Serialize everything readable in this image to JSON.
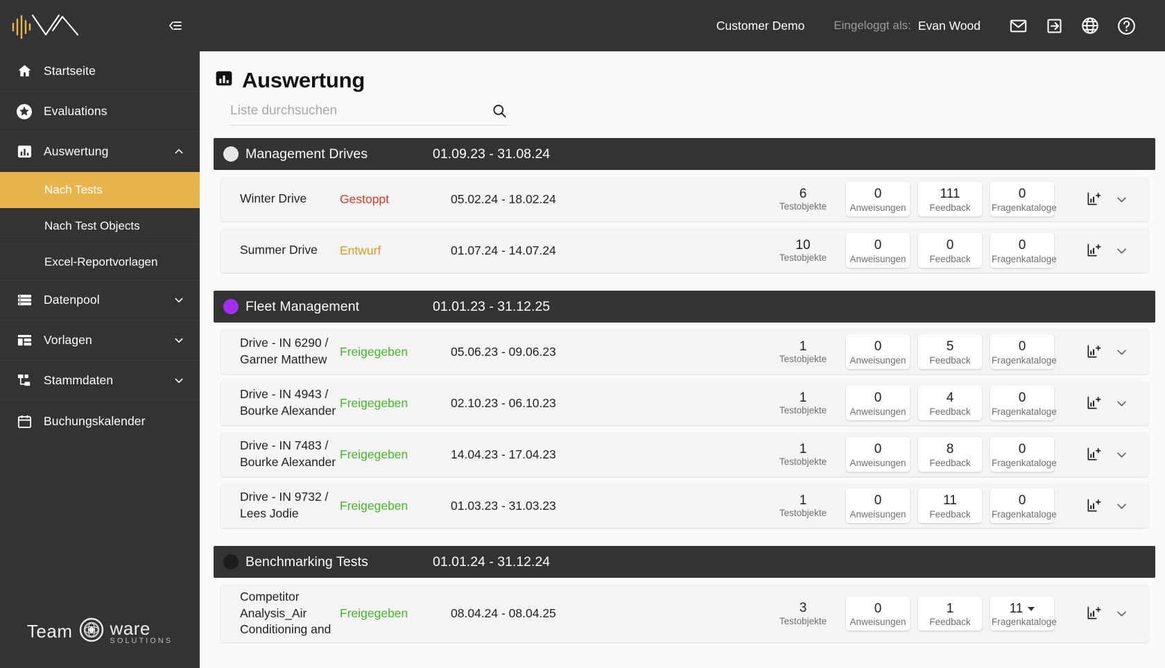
{
  "sidebar": {
    "brand_logo_name": "ava-wave-logo",
    "collapse_label": "collapse-sidebar",
    "items": [
      {
        "label": "Startseite",
        "icon": "home-icon",
        "expandable": false,
        "expanded": false
      },
      {
        "label": "Evaluations",
        "icon": "star-icon",
        "expandable": false,
        "expanded": false
      },
      {
        "label": "Auswertung",
        "icon": "bar-chart-icon",
        "expandable": true,
        "expanded": true
      },
      {
        "label": "Datenpool",
        "icon": "database-icon",
        "expandable": true,
        "expanded": false
      },
      {
        "label": "Vorlagen",
        "icon": "layout-icon",
        "expandable": true,
        "expanded": false
      },
      {
        "label": "Stammdaten",
        "icon": "hierarchy-icon",
        "expandable": true,
        "expanded": false
      },
      {
        "label": "Buchungskalender",
        "icon": "calendar-icon",
        "expandable": false,
        "expanded": false
      }
    ],
    "sub_items": [
      {
        "label": "Nach Tests",
        "selected": true
      },
      {
        "label": "Nach Test Objects",
        "selected": false
      },
      {
        "label": "Excel-Reportvorlagen",
        "selected": false
      }
    ],
    "footer_logo": {
      "left": "Team",
      "right": "ware",
      "tagline": "SOLUTIONS"
    },
    "accent_color": "#e8b54d",
    "background_color": "#333333"
  },
  "topbar": {
    "customer": "Customer Demo",
    "logged_as_label": "Eingeloggt als:",
    "user_name": "Evan Wood",
    "icons": [
      {
        "name": "mail-icon"
      },
      {
        "name": "logout-icon"
      },
      {
        "name": "globe-icon"
      },
      {
        "name": "help-icon"
      }
    ]
  },
  "page": {
    "title": "Auswertung",
    "title_icon": "bar-chart-icon"
  },
  "search": {
    "placeholder": "Liste durchsuchen",
    "value": "",
    "icon": "search-icon"
  },
  "columns": {
    "testobjekte": "Testobjekte",
    "anweisungen": "Anweisungen",
    "feedback": "Feedback",
    "fragenkataloge": "Fragenkataloge"
  },
  "groups": [
    {
      "name": "Management Drives",
      "range": "01.09.23 - 31.08.24",
      "dot_color": "#e6e6e6",
      "rows": [
        {
          "name": "Winter Drive",
          "status": "Gestoppt",
          "status_class": "st-stopped",
          "range": "05.02.24 - 18.02.24",
          "testobjekte": "6",
          "anweisungen": "0",
          "feedback": "111",
          "fragenkataloge": "0",
          "fragenkataloge_dropdown": false
        },
        {
          "name": "Summer Drive",
          "status": "Entwurf",
          "status_class": "st-draft",
          "range": "01.07.24 - 14.07.24",
          "testobjekte": "10",
          "anweisungen": "0",
          "feedback": "0",
          "fragenkataloge": "0",
          "fragenkataloge_dropdown": false
        }
      ]
    },
    {
      "name": "Fleet Management",
      "range": "01.01.23 - 31.12.25",
      "dot_color": "#a02ff0",
      "rows": [
        {
          "name": "Drive - IN 6290 / Garner Matthew",
          "status": "Freigegeben",
          "status_class": "st-released",
          "range": "05.06.23 - 09.06.23",
          "testobjekte": "1",
          "anweisungen": "0",
          "feedback": "5",
          "fragenkataloge": "0",
          "fragenkataloge_dropdown": false
        },
        {
          "name": "Drive - IN 4943 / Bourke Alexander",
          "status": "Freigegeben",
          "status_class": "st-released",
          "range": "02.10.23 - 06.10.23",
          "testobjekte": "1",
          "anweisungen": "0",
          "feedback": "4",
          "fragenkataloge": "0",
          "fragenkataloge_dropdown": false
        },
        {
          "name": "Drive - IN 7483 / Bourke Alexander",
          "status": "Freigegeben",
          "status_class": "st-released",
          "range": "14.04.23 - 17.04.23",
          "testobjekte": "1",
          "anweisungen": "0",
          "feedback": "8",
          "fragenkataloge": "0",
          "fragenkataloge_dropdown": false
        },
        {
          "name": "Drive - IN 9732 / Lees Jodie",
          "status": "Freigegeben",
          "status_class": "st-released",
          "range": "01.03.23 - 31.03.23",
          "testobjekte": "1",
          "anweisungen": "0",
          "feedback": "11",
          "fragenkataloge": "0",
          "fragenkataloge_dropdown": false
        }
      ]
    },
    {
      "name": "Benchmarking Tests",
      "range": "01.01.24 - 31.12.24",
      "dot_color": "#1c1c1c",
      "rows": [
        {
          "name": "Competitor Analysis_Air Conditioning and",
          "status": "Freigegeben",
          "status_class": "st-released",
          "range": "08.04.24 - 08.04.25",
          "testobjekte": "3",
          "anweisungen": "0",
          "feedback": "1",
          "fragenkataloge": "11",
          "fragenkataloge_dropdown": true
        }
      ]
    }
  ],
  "row_actions": {
    "report_icon": "chart-add-icon",
    "expand_icon": "chevron-down-icon"
  }
}
